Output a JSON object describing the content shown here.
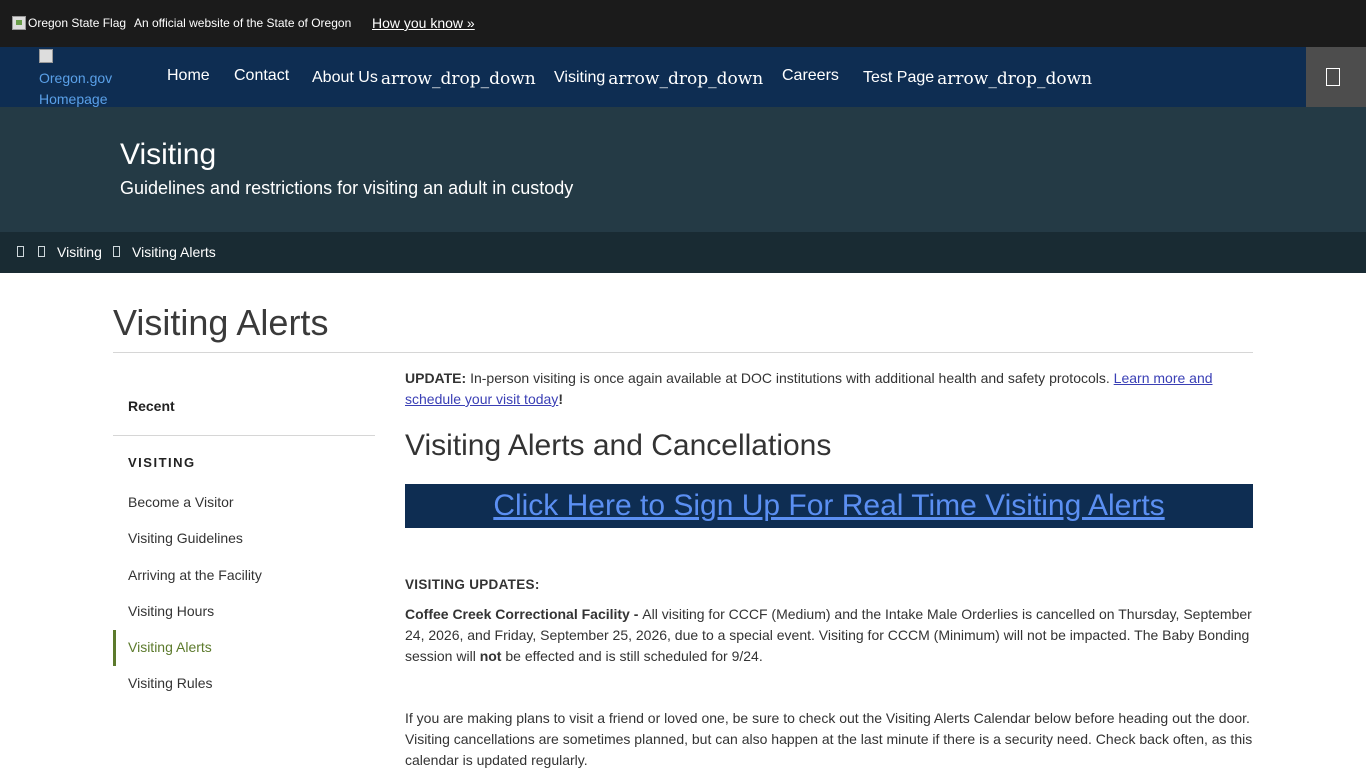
{
  "topbar": {
    "flag_alt": "Oregon State Flag",
    "official_text": "An official website of the State of Oregon",
    "how_you_know": "How you know »"
  },
  "nav": {
    "logo_line1": "Oregon.gov",
    "logo_line2": "Homepage",
    "dropdown_icon_text": "arrow_drop_down",
    "items": [
      {
        "label": "Home"
      },
      {
        "label": "Contact"
      },
      {
        "label": "About Us"
      },
      {
        "label": "Visiting"
      },
      {
        "label": "Careers"
      },
      {
        "label": "Test Page"
      }
    ]
  },
  "hero": {
    "title": "Visiting",
    "subtitle": "Guidelines and restrictions for visiting an adult in custody"
  },
  "breadcrumb": {
    "items": [
      "Visiting",
      "Visiting Alerts"
    ]
  },
  "page": {
    "title": "Visiting Alerts"
  },
  "sidebar": {
    "recent": "Recent",
    "heading": "VISITING",
    "links": [
      {
        "label": "Become a Visitor"
      },
      {
        "label": "Visiting Guidelines"
      },
      {
        "label": "Arriving at the Facility"
      },
      {
        "label": "Visiting Hours"
      },
      {
        "label": "Visiting Alerts",
        "active": true
      },
      {
        "label": "Visiting Rules"
      }
    ]
  },
  "content": {
    "update_label": "UPDATE:",
    "update_text": " In-person visiting is once again available at DOC institutions with additional health and safety protocols. ",
    "update_link": "Learn more and schedule your visit today",
    "update_end": "!",
    "section_title": "Visiting Alerts and Cancellations",
    "signup_link": "Click Here to Sign Up For Real Time Visiting Alerts",
    "updates_heading": "VISITING UPDATES:",
    "ccf_label": "Coffee Creek Correctional Facility - ",
    "ccf_text1": "All visiting for CCCF (Medium) and the Intake Male Orderlies is cancelled on Thursday, September 24, 2026, and Friday, September 25, 2026, due to a special event. Visiting for CCCM (Minimum) will not be impacted. The Baby Bonding session will ",
    "ccf_not": "not",
    "ccf_text2": " be effected and is still scheduled for 9/24.",
    "plans_text": "If you are making plans to visit a friend or loved one, be sure to check out the Visiting Alerts Calendar below before heading out the door. Visiting cancellations are sometimes planned, but can also happen at the last minute if there is a security need. Check back often, as this calendar is updated regularly."
  },
  "colors": {
    "topbar_bg": "#1b1b1b",
    "nav_bg": "#0e2d52",
    "hero_bg": "#243a45",
    "breadcrumb_bg": "#192b33",
    "active_link": "#5c7a2c",
    "link": "#3a3fb5"
  }
}
